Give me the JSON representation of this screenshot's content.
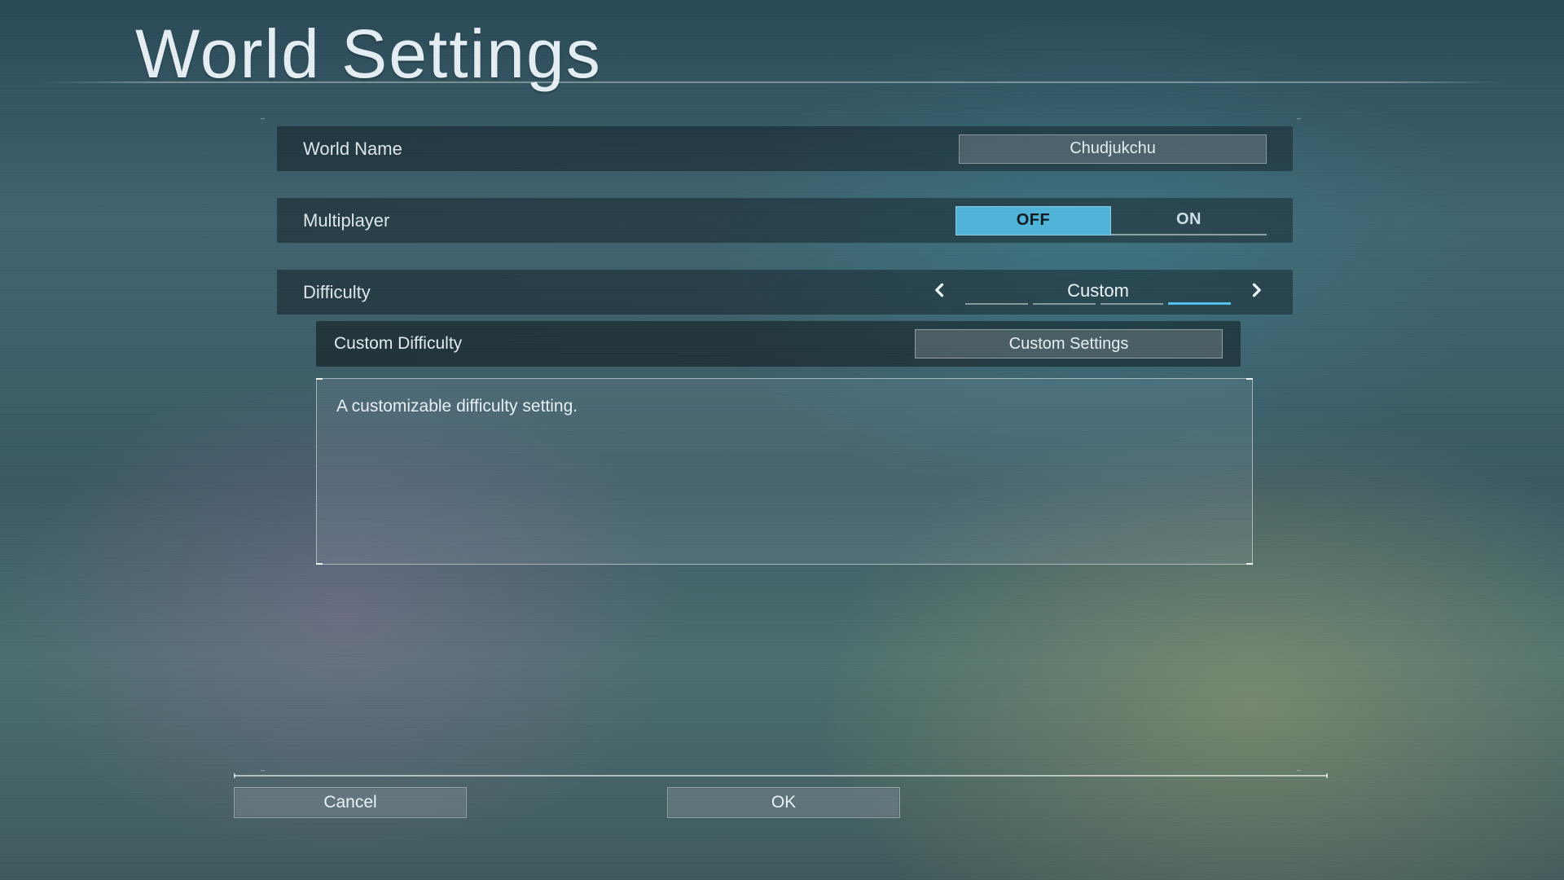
{
  "title": "World Settings",
  "rows": {
    "worldName": {
      "label": "World Name",
      "value": "Chudjukchu"
    },
    "multiplayer": {
      "label": "Multiplayer",
      "options": {
        "off": "OFF",
        "on": "ON"
      },
      "selected": "off"
    },
    "difficulty": {
      "label": "Difficulty",
      "value": "Custom",
      "segmentCount": 4,
      "activeSegment": 3
    },
    "customDifficulty": {
      "label": "Custom Difficulty",
      "button": "Custom Settings"
    }
  },
  "description": "A customizable difficulty setting.",
  "buttons": {
    "cancel": "Cancel",
    "ok": "OK"
  }
}
